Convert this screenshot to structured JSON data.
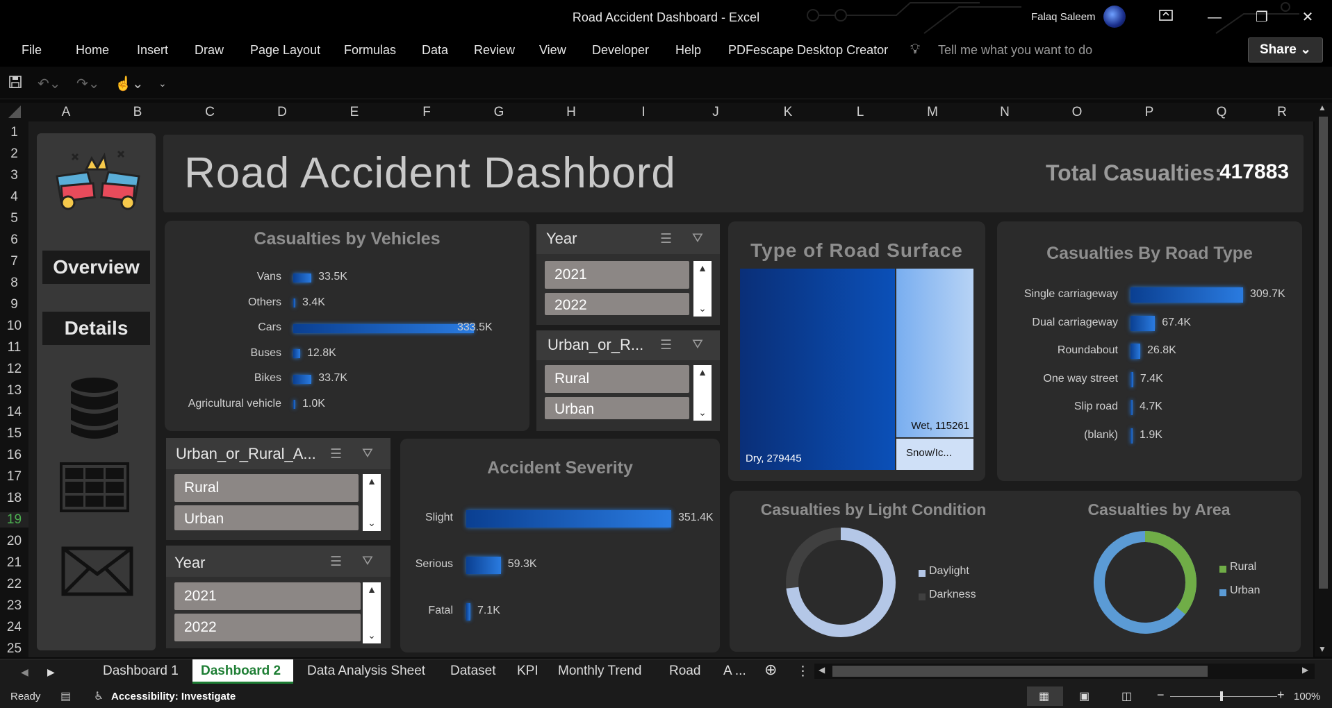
{
  "window": {
    "title": "Road Accident Dashboard  -  Excel",
    "user": "Falaq Saleem",
    "share": "Share"
  },
  "ribbon": {
    "tabs": [
      "File",
      "Home",
      "Insert",
      "Draw",
      "Page Layout",
      "Formulas",
      "Data",
      "Review",
      "View",
      "Developer",
      "Help",
      "PDFescape Desktop Creator"
    ],
    "tell_me": "Tell me what you want to do"
  },
  "columns": [
    "A",
    "B",
    "C",
    "D",
    "E",
    "F",
    "G",
    "H",
    "I",
    "J",
    "K",
    "L",
    "M",
    "N",
    "O",
    "P",
    "Q",
    "R"
  ],
  "rows": [
    "1",
    "2",
    "3",
    "4",
    "5",
    "6",
    "7",
    "8",
    "9",
    "10",
    "11",
    "12",
    "13",
    "14",
    "15",
    "16",
    "17",
    "18",
    "19",
    "20",
    "21",
    "22",
    "23",
    "24",
    "25"
  ],
  "dashboard": {
    "title": "Road Accident Dashbord",
    "total_label": "Total Casualties:",
    "total_value": "417883",
    "nav": {
      "overview": "Overview",
      "details": "Details"
    }
  },
  "vehicles_chart": {
    "title": "Casualties by Vehicles",
    "categories": [
      "Vans",
      "Others",
      "Cars",
      "Buses",
      "Bikes",
      "Agricultural vehicle"
    ],
    "values": [
      33.5,
      3.4,
      333.5,
      12.8,
      33.7,
      1.0
    ],
    "labels": [
      "33.5K",
      "3.4K",
      "333.5K",
      "12.8K",
      "33.7K",
      "1.0K"
    ]
  },
  "slicer_year_top": {
    "title": "Year",
    "items": [
      "2021",
      "2022"
    ]
  },
  "slicer_urban_top": {
    "title": "Urban_or_R...",
    "items": [
      "Rural",
      "Urban"
    ]
  },
  "slicer_urban_bottom": {
    "title": "Urban_or_Rural_A...",
    "items": [
      "Rural",
      "Urban"
    ]
  },
  "slicer_year_bottom": {
    "title": "Year",
    "items": [
      "2021",
      "2022"
    ]
  },
  "surface_chart": {
    "title": "Type of Road Surface",
    "labels": [
      "Dry, 279445",
      "Wet, 115261",
      "Snow/Ic..."
    ]
  },
  "road_type_chart": {
    "title": "Casualties By Road Type",
    "categories": [
      "Single carriageway",
      "Dual carriageway",
      "Roundabout",
      "One way street",
      "Slip road",
      "(blank)"
    ],
    "values": [
      309.7,
      67.4,
      26.8,
      7.4,
      4.7,
      1.9
    ],
    "labels": [
      "309.7K",
      "67.4K",
      "26.8K",
      "7.4K",
      "4.7K",
      "1.9K"
    ]
  },
  "severity_chart": {
    "title": "Accident Severity",
    "categories": [
      "Slight",
      "Serious",
      "Fatal"
    ],
    "values": [
      351.4,
      59.3,
      7.1
    ],
    "labels": [
      "351.4K",
      "59.3K",
      "7.1K"
    ]
  },
  "light_chart": {
    "title": "Casualties by Light Condition",
    "legend": [
      "Daylight",
      "Darkness"
    ],
    "colors": [
      "#b4c7e7",
      "#404040"
    ]
  },
  "area_chart": {
    "title": "Casualties by Area",
    "legend": [
      "Rural",
      "Urban"
    ],
    "colors": [
      "#70ad47",
      "#5b9bd5"
    ]
  },
  "chart_data": [
    {
      "type": "bar",
      "title": "Casualties by Vehicles",
      "categories": [
        "Vans",
        "Others",
        "Cars",
        "Buses",
        "Bikes",
        "Agricultural vehicle"
      ],
      "values": [
        33500,
        3400,
        333500,
        12800,
        33700,
        1000
      ]
    },
    {
      "type": "bar",
      "title": "Casualties By Road Type",
      "categories": [
        "Single carriageway",
        "Dual carriageway",
        "Roundabout",
        "One way street",
        "Slip road",
        "(blank)"
      ],
      "values": [
        309700,
        67400,
        26800,
        7400,
        4700,
        1900
      ]
    },
    {
      "type": "bar",
      "title": "Accident Severity",
      "categories": [
        "Slight",
        "Serious",
        "Fatal"
      ],
      "values": [
        351400,
        59300,
        7100
      ]
    },
    {
      "type": "heatmap",
      "title": "Type of Road Surface",
      "categories": [
        "Dry",
        "Wet",
        "Snow/Ic..."
      ],
      "values": [
        279445,
        115261,
        23177
      ]
    },
    {
      "type": "pie",
      "title": "Casualties by Light Condition",
      "categories": [
        "Daylight",
        "Darkness"
      ],
      "values": [
        306000,
        112000
      ]
    },
    {
      "type": "pie",
      "title": "Casualties by Area",
      "categories": [
        "Rural",
        "Urban"
      ],
      "values": [
        149000,
        269000
      ]
    }
  ],
  "sheet_tabs": [
    "Dashboard 1",
    "Dashboard 2",
    "Data Analysis Sheet",
    "Dataset",
    "KPI",
    "Monthly Trend",
    "Road",
    "A ..."
  ],
  "status": {
    "ready": "Ready",
    "accessibility": "Accessibility: Investigate",
    "zoom": "100%"
  }
}
